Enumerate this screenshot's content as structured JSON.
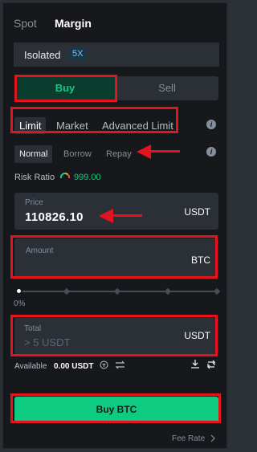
{
  "tabs": {
    "spot": "Spot",
    "margin": "Margin"
  },
  "isolated": {
    "label": "Isolated",
    "leverage": "5X"
  },
  "side": {
    "buy": "Buy",
    "sell": "Sell"
  },
  "order_types": {
    "limit": "Limit",
    "market": "Market",
    "advanced": "Advanced Limit"
  },
  "modes": {
    "normal": "Normal",
    "borrow": "Borrow",
    "repay": "Repay"
  },
  "risk": {
    "label": "Risk Ratio",
    "value": "999.00"
  },
  "price": {
    "label": "Price",
    "value": "110826.10",
    "unit": "USDT"
  },
  "amount": {
    "label": "Amount",
    "unit": "BTC"
  },
  "slider": {
    "percent_label": "0%",
    "level": 0
  },
  "total": {
    "label": "Total",
    "placeholder": "> 5 USDT",
    "unit": "USDT"
  },
  "available": {
    "label": "Available",
    "value": "0.00 USDT"
  },
  "submit": {
    "label": "Buy BTC"
  },
  "fee_rate": {
    "label": "Fee Rate"
  },
  "colors": {
    "buy_green": "#0ecb81",
    "annotation_red": "#e5131d",
    "panel_bg": "#17181c",
    "field_bg": "#2b2f36"
  },
  "icons": [
    "info-icon",
    "risk-gauge-icon",
    "transfer-icon",
    "convert-icon",
    "download-icon",
    "swap-icon",
    "chevron-right-icon"
  ]
}
